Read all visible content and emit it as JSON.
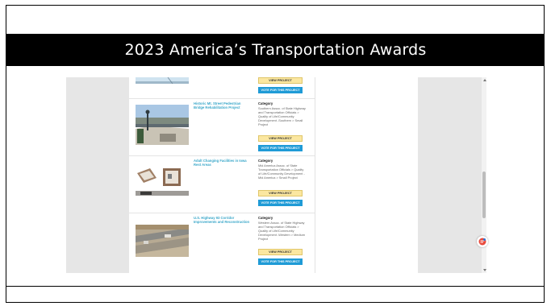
{
  "slide": {
    "title": "2023 America’s Transportation Awards"
  },
  "projects": [
    {
      "title": "",
      "category_label": "",
      "category_text": "",
      "view_label": "VIEW PROJECT",
      "vote_label": "VOTE FOR THIS PROJECT"
    },
    {
      "title": "Historic Mt. Street Pedestrian Bridge Rehabilitation Project",
      "category_label": "Category",
      "category_text": "Southern Assoc. of State Highway and Transportation Officials > Quality of Life/Community Development -Southern > Small Project",
      "view_label": "VIEW PROJECT",
      "vote_label": "VOTE FOR THIS PROJECT"
    },
    {
      "title": "Adult Changing Facilities in Iowa Rest Areas",
      "category_label": "Category",
      "category_text": "Mid America Assoc. of State Transportation Officials > Quality of Life/Community Development - Mid America > Small Project",
      "view_label": "VIEW PROJECT",
      "vote_label": "VOTE FOR THIS PROJECT"
    },
    {
      "title": "U.S. Highway 93 Corridor Improvements and Reconstruction",
      "category_label": "Category",
      "category_text": "Western Assoc. of State Highway and Transportation Officials > Quality of Life/Community Development -Western > Medium Project",
      "view_label": "VIEW PROJECT",
      "vote_label": "VOTE FOR THIS PROJECT"
    }
  ],
  "icons": {
    "chat": "chat-bubble-icon",
    "scroll_up": "scroll-up-arrow-icon",
    "scroll_down": "scroll-down-arrow-icon"
  },
  "colors": {
    "banner_bg": "#000000",
    "title_link": "#3aa7c9",
    "view_button": "#fbe7a0",
    "vote_button": "#1f9bd6",
    "side_gray": "#e6e6e6"
  }
}
